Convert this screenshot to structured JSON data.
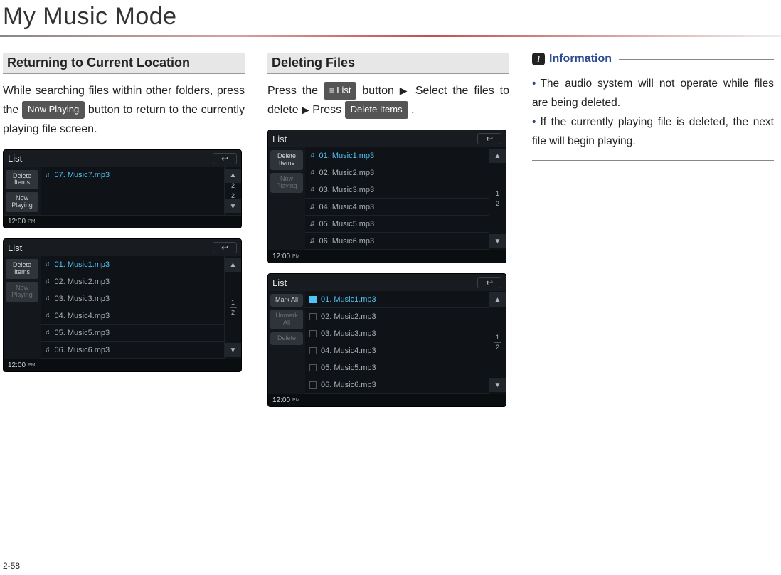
{
  "page": {
    "title": "My Music Mode",
    "number": "2-58"
  },
  "col1": {
    "heading": "Returning to Current Location",
    "para_a": "While searching files within other folders, press the ",
    "btn": "Now Playing",
    "para_b": " button to return to the currently playing file screen."
  },
  "col2": {
    "heading": "Deleting Files",
    "para_a": "Press the ",
    "btn1": "List",
    "para_b": " button ",
    "arrow": "▶",
    "para_c": " Select the files to delete ",
    "para_d": " Press ",
    "btn2": "Delete Items",
    "period": " ."
  },
  "col3": {
    "heading": "Information",
    "item1": "The audio system will not operate while files are being deleted.",
    "item2": "If the currently playing file is deleted, the next file will begin playing."
  },
  "ss": {
    "list_label": "List",
    "delete_items": "Delete\nItems",
    "now_playing": "Now\nPlaying",
    "mark_all": "Mark All",
    "unmark_all": "Unmark\nAll",
    "delete": "Delete",
    "clock": "12:00",
    "ampm": "PM",
    "back": "↩",
    "up": "▲",
    "down": "▼",
    "a": {
      "rows": [
        "07. Music7.mp3"
      ],
      "page_cur": "2",
      "page_tot": "2"
    },
    "b": {
      "rows": [
        "01. Music1.mp3",
        "02. Music2.mp3",
        "03. Music3.mp3",
        "04. Music4.mp3",
        "05. Music5.mp3",
        "06. Music6.mp3"
      ],
      "page_cur": "1",
      "page_tot": "2"
    },
    "c": {
      "rows": [
        "01. Music1.mp3",
        "02. Music2.mp3",
        "03. Music3.mp3",
        "04. Music4.mp3",
        "05. Music5.mp3",
        "06. Music6.mp3"
      ],
      "page_cur": "1",
      "page_tot": "2"
    },
    "d": {
      "rows": [
        "01. Music1.mp3",
        "02. Music2.mp3",
        "03. Music3.mp3",
        "04. Music4.mp3",
        "05. Music5.mp3",
        "06. Music6.mp3"
      ],
      "page_cur": "1",
      "page_tot": "2"
    }
  }
}
